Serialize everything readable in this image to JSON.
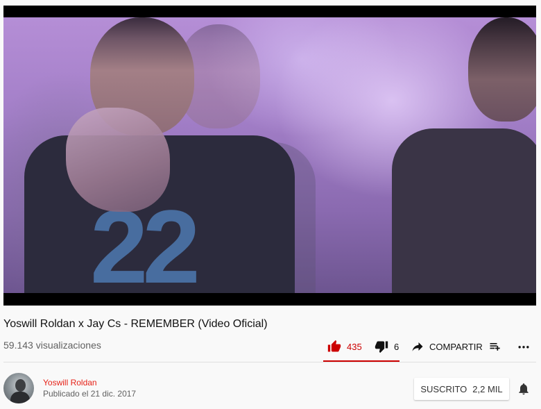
{
  "video": {
    "title": "Yoswill Roldan x Jay Cs - REMEMBER (Video Oficial)",
    "views": "59.143 visualizaciones",
    "shirt_number": "22"
  },
  "actions": {
    "likes": "435",
    "dislikes": "6",
    "share_label": "COMPARTIR",
    "like_active_color": "#cc0000"
  },
  "channel": {
    "name": "Yoswill Roldan",
    "published": "Publicado el 21 dic. 2017",
    "subscribe_label": "SUSCRITO",
    "subscriber_count": "2,2 MIL"
  },
  "icons": {
    "like": "thumbs-up-icon",
    "dislike": "thumbs-down-icon",
    "share": "share-arrow-icon",
    "add_to_playlist": "add-to-playlist-icon",
    "more": "more-dots-icon",
    "notification": "bell-icon"
  }
}
